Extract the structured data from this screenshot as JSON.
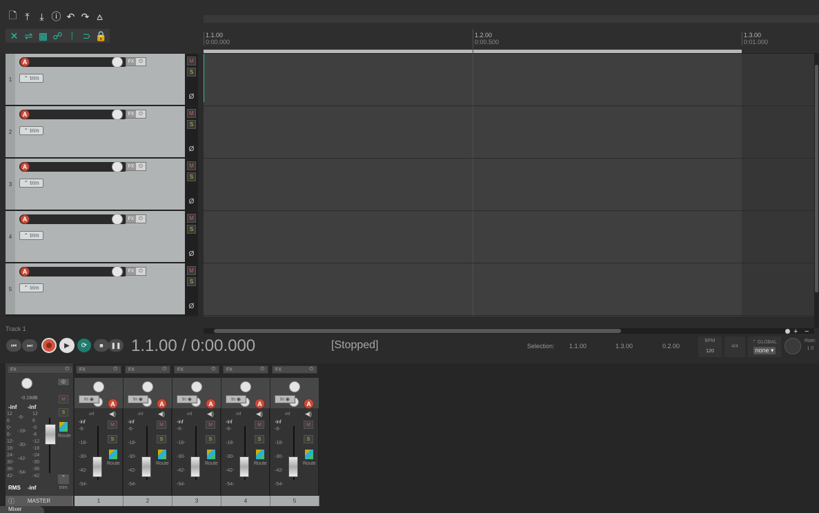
{
  "toolbar": {
    "row1": [
      {
        "icon": "new-project-icon",
        "glyph": "🗋"
      },
      {
        "icon": "open-project-icon",
        "glyph": "⤒"
      },
      {
        "icon": "save-project-icon",
        "glyph": "⤓"
      },
      {
        "icon": "project-info-icon",
        "glyph": "ⓘ"
      },
      {
        "icon": "undo-icon",
        "glyph": "↶"
      },
      {
        "icon": "redo-icon",
        "glyph": "↷"
      },
      {
        "icon": "metronome-icon",
        "glyph": "⩟"
      }
    ],
    "row2": [
      {
        "icon": "auto-crossfade-icon",
        "glyph": "✕"
      },
      {
        "icon": "ripple-edit-icon",
        "glyph": "⇌"
      },
      {
        "icon": "grid-icon",
        "glyph": "▦"
      },
      {
        "icon": "item-grouping-icon",
        "glyph": "☍"
      },
      {
        "icon": "snap-icon",
        "glyph": "⁞"
      },
      {
        "icon": "envelope-lock-icon",
        "glyph": "⊃"
      },
      {
        "icon": "lock-icon",
        "glyph": "🔒"
      }
    ]
  },
  "ruler": {
    "marks": [
      {
        "bar": "1.1.00",
        "time": "0:00.000"
      },
      {
        "bar": "1.2.00",
        "time": "0:00.500"
      },
      {
        "bar": "1.3.00",
        "time": "0:01.000"
      }
    ]
  },
  "tracks": [
    {
      "num": "1",
      "rec": "A",
      "fx": "FX",
      "trim": "trim",
      "mute": "M",
      "solo": "S",
      "phase": "Ø"
    },
    {
      "num": "2",
      "rec": "A",
      "fx": "FX",
      "trim": "trim",
      "mute": "M",
      "solo": "S",
      "phase": "Ø"
    },
    {
      "num": "3",
      "rec": "A",
      "fx": "FX",
      "trim": "trim",
      "mute": "M",
      "solo": "S",
      "phase": "Ø"
    },
    {
      "num": "4",
      "rec": "A",
      "fx": "FX",
      "trim": "trim",
      "mute": "M",
      "solo": "S",
      "phase": "Ø"
    },
    {
      "num": "5",
      "rec": "A",
      "fx": "FX",
      "trim": "trim",
      "mute": "M",
      "solo": "S",
      "phase": "Ø"
    }
  ],
  "track_info": "Track 1",
  "transport": {
    "timecode": "1.1.00 / 0:00.000",
    "state": "[Stopped]",
    "selection_label": "Selection:",
    "sel_start": "1.1.00",
    "sel_end": "1.3.00",
    "sel_length": "0.2.00",
    "bpm_label": "BPM",
    "bpm": "120",
    "timesig": "4/4",
    "global_label": "GLOBAL",
    "global_value": "none",
    "rate_label": "Rate:",
    "rate_value": "1.0"
  },
  "master": {
    "fx": "FX",
    "peak": "-0.19dB",
    "left": "-inf",
    "right": "-inf",
    "mute": "M",
    "solo": "S",
    "route": "Route",
    "rms_label": "RMS",
    "rms_value": "-inf",
    "trim": "trim",
    "label": "MASTER",
    "scale_left": [
      "12",
      "6",
      "0-",
      "6-",
      "12-",
      "18-",
      "24-",
      "30-",
      "36-",
      "42-"
    ],
    "scale_mid": [
      "-6-",
      "-18-",
      "-30-",
      "-42-",
      "-54-"
    ],
    "scale_right": [
      "12",
      "6",
      "-0",
      "-6",
      "-12",
      "-18",
      "-24",
      "-30",
      "-36",
      "-42"
    ]
  },
  "mixer_strips": [
    {
      "num": "1",
      "fx": "FX",
      "in": "In",
      "rec": "A",
      "vol": "-inf",
      "peak": "-inf",
      "mute": "M",
      "solo": "S",
      "route": "Route"
    },
    {
      "num": "2",
      "fx": "FX",
      "in": "In",
      "rec": "A",
      "vol": "-inf",
      "peak": "-inf",
      "mute": "M",
      "solo": "S",
      "route": "Route"
    },
    {
      "num": "3",
      "fx": "FX",
      "in": "In",
      "rec": "A",
      "vol": "-inf",
      "peak": "-inf",
      "mute": "M",
      "solo": "S",
      "route": "Route"
    },
    {
      "num": "4",
      "fx": "FX",
      "in": "In",
      "rec": "A",
      "vol": "-inf",
      "peak": "-inf",
      "mute": "M",
      "solo": "S",
      "route": "Route"
    },
    {
      "num": "5",
      "fx": "FX",
      "in": "In",
      "rec": "A",
      "vol": "-inf",
      "peak": "-inf",
      "mute": "M",
      "solo": "S",
      "route": "Route"
    }
  ],
  "strip_scale": [
    "-6-",
    "-18-",
    "-30-",
    "-42-",
    "-54-"
  ],
  "mixer_tab": "Mixer"
}
